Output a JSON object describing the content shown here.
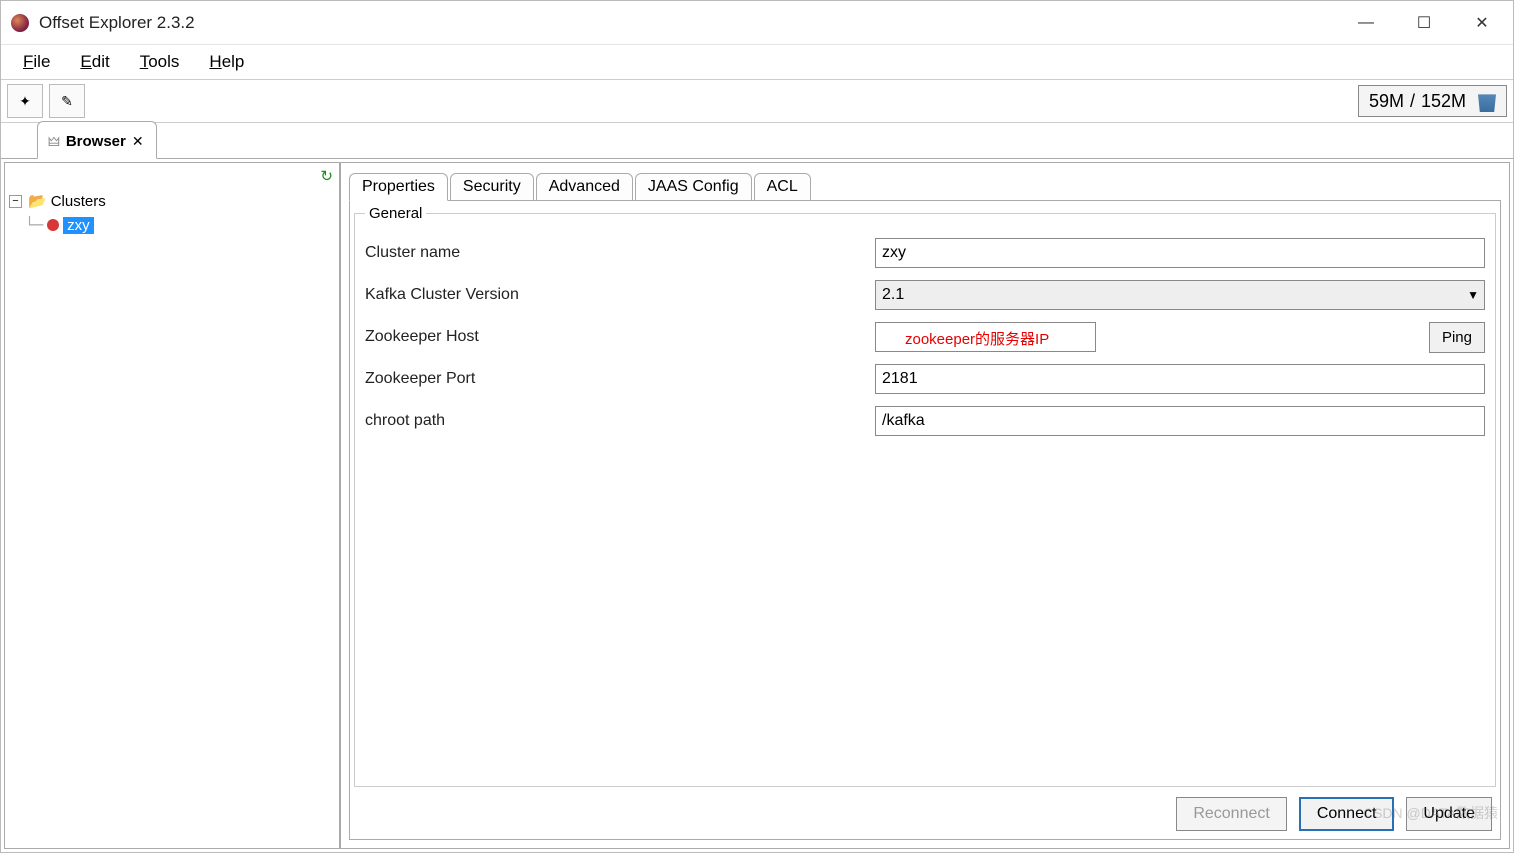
{
  "window": {
    "title": "Offset Explorer  2.3.2"
  },
  "menubar": {
    "file": "File",
    "edit": "Edit",
    "tools": "Tools",
    "help": "Help"
  },
  "toolbar": {
    "memory_used": "59M",
    "memory_total": "152M",
    "memory_sep": " / "
  },
  "browserTab": {
    "title": "Browser"
  },
  "tree": {
    "root": "Clusters",
    "nodes": [
      {
        "name": "zxy"
      }
    ]
  },
  "tabs": {
    "properties": "Properties",
    "security": "Security",
    "advanced": "Advanced",
    "jaas": "JAAS Config",
    "acl": "ACL"
  },
  "form": {
    "legend": "General",
    "cluster_name_label": "Cluster name",
    "cluster_name_value": "zxy",
    "kafka_version_label": "Kafka Cluster Version",
    "kafka_version_value": "2.1",
    "zk_host_label": "Zookeeper Host",
    "zk_host_value": "",
    "zk_host_annotation": "zookeeper的服务器IP",
    "ping_label": "Ping",
    "zk_port_label": "Zookeeper Port",
    "zk_port_value": "2181",
    "chroot_label": "chroot path",
    "chroot_value": "/kafka"
  },
  "buttons": {
    "reconnect": "Reconnect",
    "connect": "Connect",
    "update": "Update"
  },
  "watermark": "CSDN @DATA数据猿"
}
